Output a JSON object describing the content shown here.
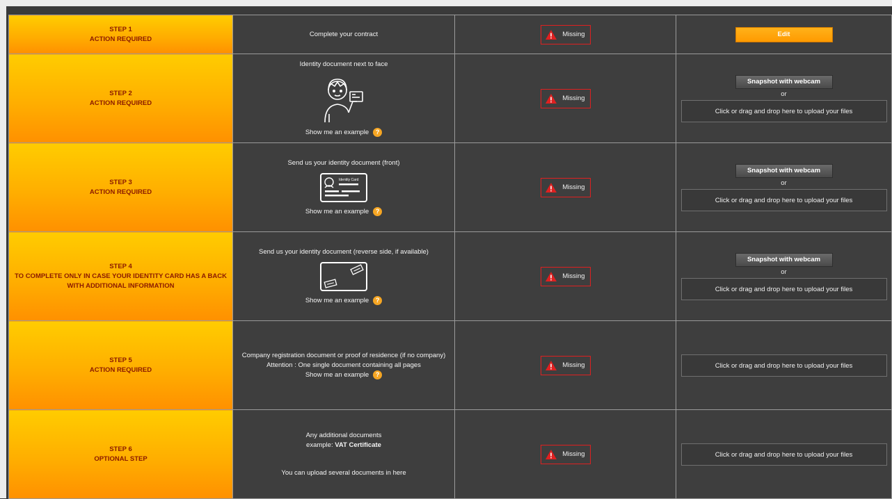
{
  "colors": {
    "accent": "#ff9a00",
    "missing_border": "#e02020",
    "step_text": "#8b1a00"
  },
  "steps": [
    {
      "title": "STEP 1",
      "subtitle": "ACTION REQUIRED",
      "desc": "Complete your contract",
      "status": "Missing",
      "action_label": "Edit"
    },
    {
      "title": "STEP 2",
      "subtitle": "ACTION REQUIRED",
      "desc": "Identity document next to face",
      "example": "Show me an example",
      "status": "Missing",
      "webcam": "Snapshot with webcam",
      "or": "or",
      "upload": "Click or drag and drop here to upload your files"
    },
    {
      "title": "STEP 3",
      "subtitle": "ACTION REQUIRED",
      "desc": "Send us your identity document (front)",
      "example": "Show me an example",
      "status": "Missing",
      "webcam": "Snapshot with webcam",
      "or": "or",
      "upload": "Click or drag and drop here to upload your files",
      "card_label": "Identity Card"
    },
    {
      "title": "STEP 4",
      "subtitle_line1": "TO COMPLETE ONLY IN CASE YOUR IDENTITY CARD HAS A BACK",
      "subtitle_line2": "WITH ADDITIONAL INFORMATION",
      "desc": "Send us your identity document (reverse side, if available)",
      "example": "Show me an example",
      "status": "Missing",
      "webcam": "Snapshot with webcam",
      "or": "or",
      "upload": "Click or drag and drop here to upload your files"
    },
    {
      "title": "STEP 5",
      "subtitle": "ACTION REQUIRED",
      "desc_line1": "Company registration document or proof of residence (if no company)",
      "desc_line2": "Attention : One single document containing all pages",
      "example": "Show me an example",
      "status": "Missing",
      "upload": "Click or drag and drop here to upload your files"
    },
    {
      "title": "STEP 6",
      "subtitle": "OPTIONAL STEP",
      "desc_line1": "Any additional documents",
      "desc_line2_prefix": "example: ",
      "desc_line2_bold": "VAT Certificate",
      "desc_line3": "You can upload several documents in here",
      "status": "Missing",
      "upload": "Click or drag and drop here to upload your files"
    }
  ]
}
